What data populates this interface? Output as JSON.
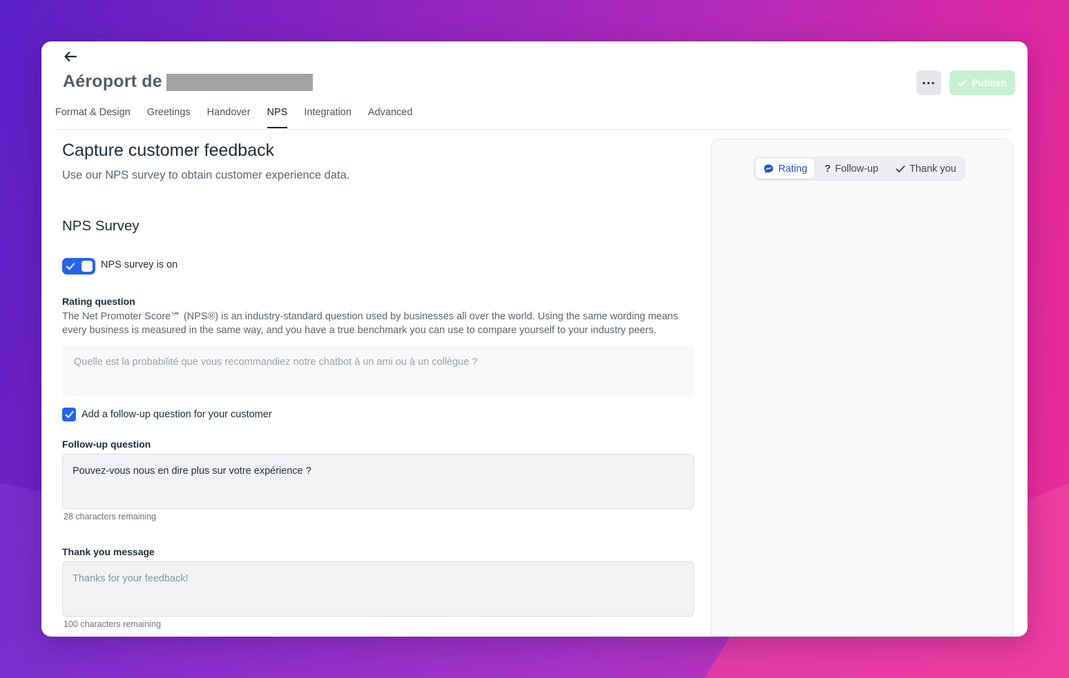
{
  "header": {
    "back_icon": "arrow-left-icon",
    "title": "Aéroport de",
    "more_icon": "more-horizontal-icon",
    "publish_label": "Publish"
  },
  "tabs": [
    {
      "label": "Format & Design",
      "active": false
    },
    {
      "label": "Greetings",
      "active": false
    },
    {
      "label": "Handover",
      "active": false
    },
    {
      "label": "NPS",
      "active": true
    },
    {
      "label": "Integration",
      "active": false
    },
    {
      "label": "Advanced",
      "active": false
    }
  ],
  "main": {
    "heading": "Capture customer feedback",
    "subheading": "Use our NPS survey to obtain customer experience data.",
    "section_title": "NPS Survey",
    "toggle": {
      "label": "NPS survey is on",
      "on": true
    },
    "rating": {
      "label": "Rating question",
      "help": "The Net Promoter Score℠ (NPS®) is an industry-standard question used by businesses all over the world. Using the same wording means every business is measured in the same way, and you have a true benchmark you can use to compare yourself to your industry peers.",
      "text": "Quelle est la probabilité que vous recommandiez notre chatbot à un ami ou à un collègue ?"
    },
    "followup_checkbox": {
      "label": "Add a follow-up question for your customer",
      "checked": true
    },
    "followup": {
      "label": "Follow-up question",
      "value": "Pouvez-vous nous en dire plus sur votre expérience ?",
      "counter": "28 characters remaining"
    },
    "thanks": {
      "label": "Thank you message",
      "placeholder": "Thanks for your feedback!",
      "counter": "100 characters remaining"
    }
  },
  "preview": {
    "segments": [
      {
        "label": "Rating",
        "icon": "chat-bubble-icon",
        "active": true
      },
      {
        "label": "Follow-up",
        "icon": "question-mark-icon",
        "active": false
      },
      {
        "label": "Thank you",
        "icon": "check-icon",
        "active": false
      }
    ]
  },
  "colors": {
    "accent": "#2563eb",
    "publish_disabled": "#c8f0d3",
    "active_segment_text": "#1d4fd8"
  }
}
